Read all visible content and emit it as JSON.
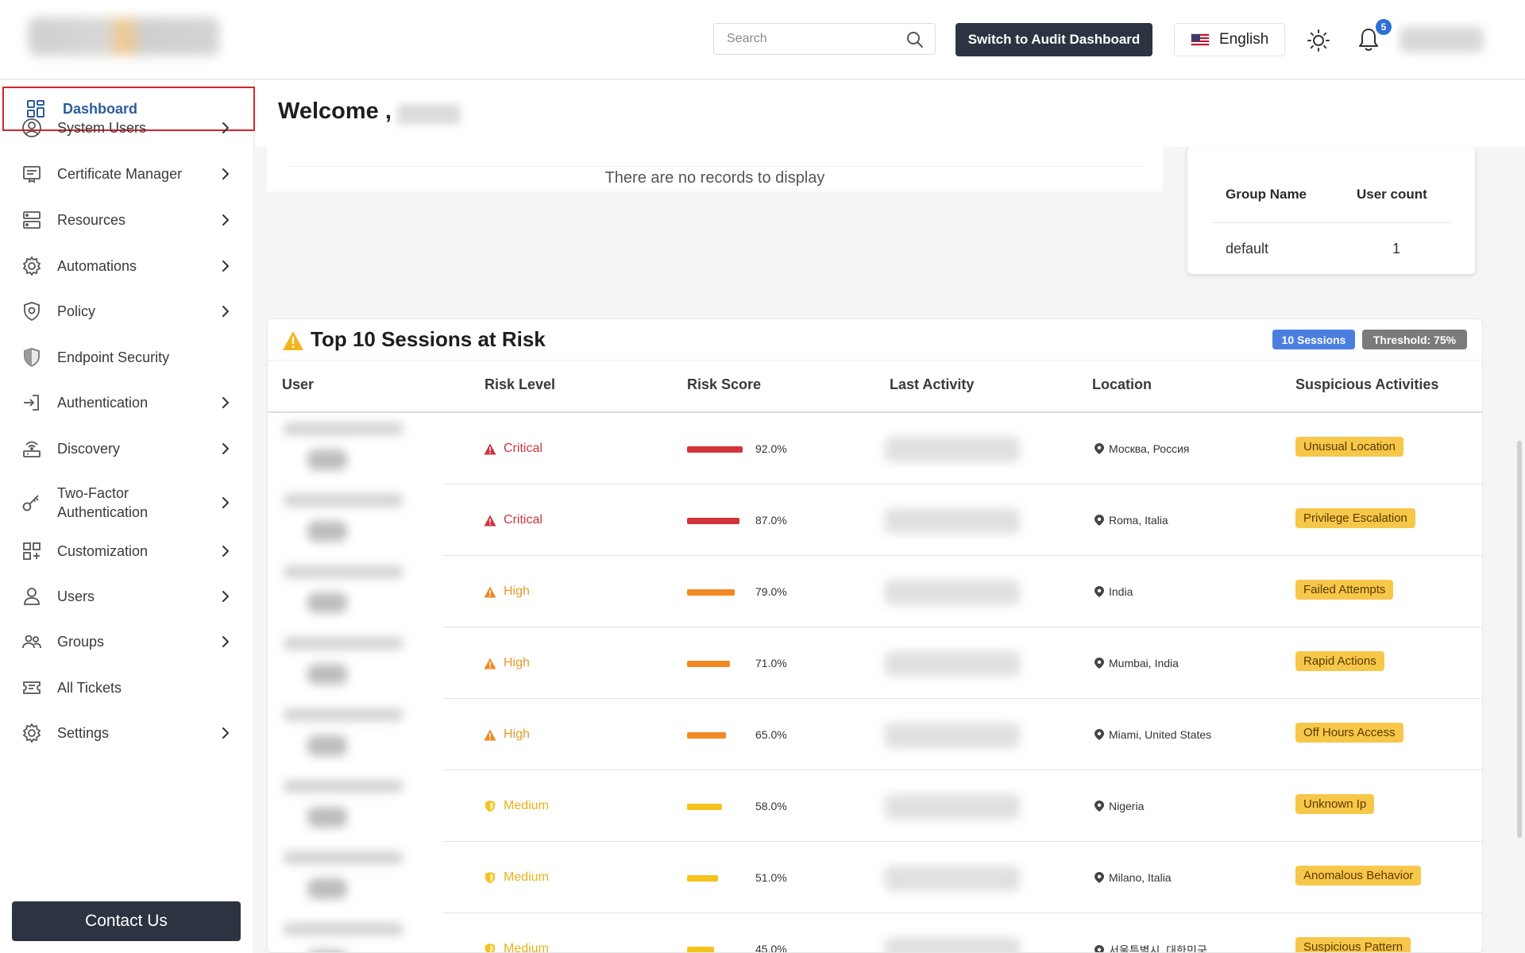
{
  "header": {
    "search_placeholder": "Search",
    "audit_button": "Switch to Audit Dashboard",
    "language": "English",
    "notification_count": "5"
  },
  "sidebar": {
    "items": [
      {
        "label": "Dashboard",
        "icon": "dashboard-grid-icon",
        "chevron": false,
        "active": true
      },
      {
        "label": "System Users",
        "icon": "user-circle-icon",
        "chevron": true
      },
      {
        "label": "Certificate Manager",
        "icon": "certificate-icon",
        "chevron": true
      },
      {
        "label": "Resources",
        "icon": "server-icon",
        "chevron": true
      },
      {
        "label": "Automations",
        "icon": "gear-icon",
        "chevron": true
      },
      {
        "label": "Policy",
        "icon": "shield-lock-icon",
        "chevron": true
      },
      {
        "label": "Endpoint Security",
        "icon": "shield-icon",
        "chevron": false
      },
      {
        "label": "Authentication",
        "icon": "login-icon",
        "chevron": true
      },
      {
        "label": "Discovery",
        "icon": "network-icon",
        "chevron": true
      },
      {
        "label": "Two-Factor",
        "label2": "Authentication",
        "icon": "key-icon",
        "chevron": true
      },
      {
        "label": "Customization",
        "icon": "grid-plus-icon",
        "chevron": true
      },
      {
        "label": "Users",
        "icon": "user-icon",
        "chevron": true
      },
      {
        "label": "Groups",
        "icon": "group-icon",
        "chevron": true
      },
      {
        "label": "All Tickets",
        "icon": "ticket-icon",
        "chevron": false
      },
      {
        "label": "Settings",
        "icon": "settings-icon",
        "chevron": true
      }
    ],
    "contact_button": "Contact Us"
  },
  "main": {
    "welcome": "Welcome ,",
    "no_records": "There are no records to display",
    "group_table": {
      "headers": [
        "Group Name",
        "User count"
      ],
      "rows": [
        [
          "default",
          "1"
        ]
      ]
    },
    "risk": {
      "title": "Top 10 Sessions at Risk",
      "sessions_pill": "10 Sessions",
      "threshold_pill": "Threshold: 75%",
      "headers": [
        "User",
        "Risk Level",
        "Risk Score",
        "Last Activity",
        "Location",
        "Suspicious Activities"
      ],
      "rows": [
        {
          "level": "Critical",
          "score": "92.0%",
          "score_value": 92.0,
          "location": "Москва, Россия",
          "activity": "Unusual Location"
        },
        {
          "level": "Critical",
          "score": "87.0%",
          "score_value": 87.0,
          "location": "Roma, Italia",
          "activity": "Privilege Escalation"
        },
        {
          "level": "High",
          "score": "79.0%",
          "score_value": 79.0,
          "location": "India",
          "activity": "Failed Attempts"
        },
        {
          "level": "High",
          "score": "71.0%",
          "score_value": 71.0,
          "location": "Mumbai, India",
          "activity": "Rapid Actions"
        },
        {
          "level": "High",
          "score": "65.0%",
          "score_value": 65.0,
          "location": "Miami, United States",
          "activity": "Off Hours Access"
        },
        {
          "level": "Medium",
          "score": "58.0%",
          "score_value": 58.0,
          "location": "Nigeria",
          "activity": "Unknown Ip"
        },
        {
          "level": "Medium",
          "score": "51.0%",
          "score_value": 51.0,
          "location": "Milano, Italia",
          "activity": "Anomalous Behavior"
        },
        {
          "level": "Medium",
          "score": "45.0%",
          "score_value": 45.0,
          "location": "서울특별시, 대한민국",
          "activity": "Suspicious Pattern"
        }
      ]
    }
  },
  "colors": {
    "critical": "#d1343b",
    "high": "#f08a24",
    "medium": "#f4c21a",
    "tag_bg": "#f7c74a",
    "dark_button": "#2c3441",
    "active_nav_border": "#d8232a",
    "active_nav_text": "#2b5c9c"
  }
}
